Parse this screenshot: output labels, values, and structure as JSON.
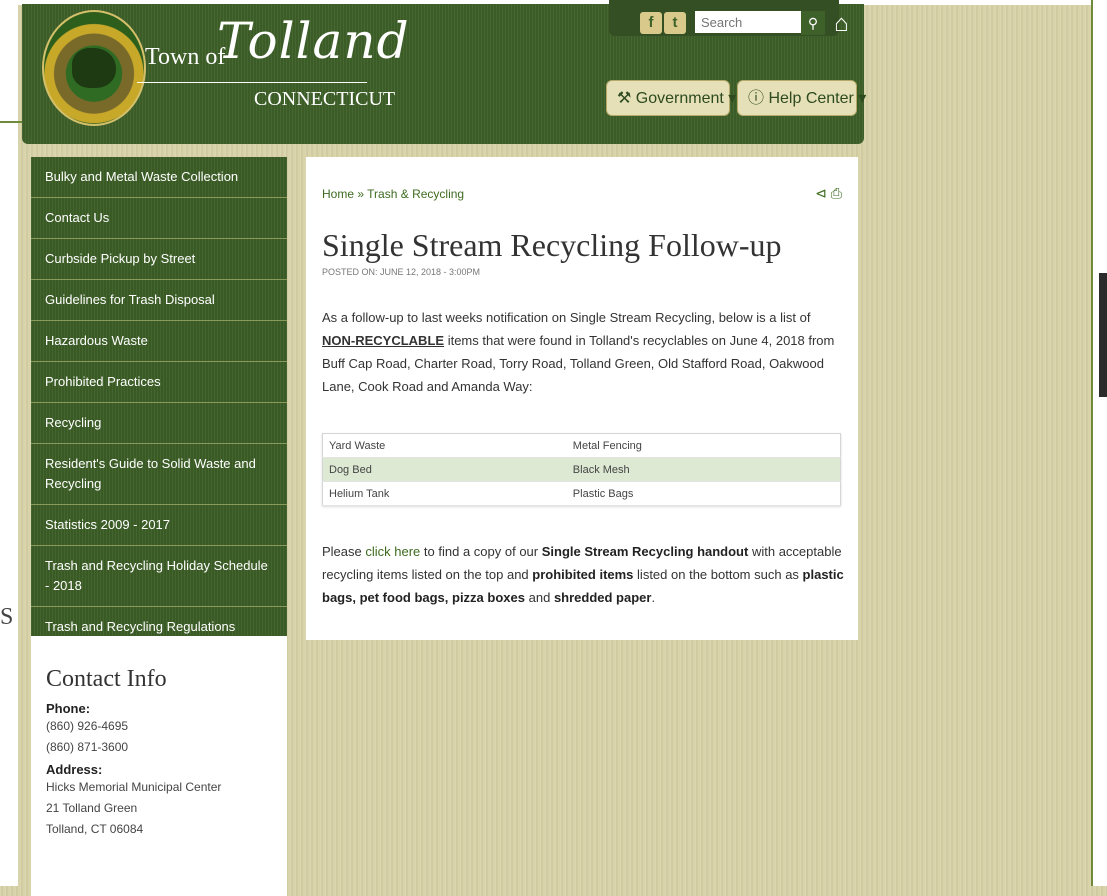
{
  "header": {
    "town_of": "Town of",
    "town_name": "Tolland",
    "state": "CONNECTICUT",
    "search_placeholder": "Search",
    "nav": {
      "government": "Government",
      "help_center": "Help Center"
    }
  },
  "sidebar": {
    "items": [
      "Bulky and Metal Waste Collection",
      "Contact Us",
      "Curbside Pickup by Street",
      "Guidelines for Trash Disposal",
      "Hazardous Waste",
      "Prohibited Practices",
      "Recycling",
      "Resident's Guide to Solid Waste and Recycling",
      "Statistics 2009 - 2017",
      "Trash and Recycling Holiday Schedule - 2018",
      "Trash and Recycling Regulations"
    ]
  },
  "contact": {
    "title": "Contact Info",
    "phone_label": "Phone:",
    "phone1": "(860) 926-4695",
    "phone2": "(860) 871-3600",
    "address_label": "Address:",
    "address1": "Hicks Memorial Municipal Center",
    "address2": "21 Tolland Green",
    "address3": "Tolland, CT 06084"
  },
  "article": {
    "breadcrumb_home": "Home",
    "breadcrumb_sep": "»",
    "breadcrumb_section": "Trash & Recycling",
    "title": "Single Stream Recycling Follow-up",
    "posted": "POSTED ON: JUNE 12, 2018 - 3:00PM",
    "intro_part1": "As a follow-up to last weeks notification on Single Stream Recycling, below is a list of",
    "intro_strong": "NON-RECYCLABLE",
    "intro_part2": "items that were found in Tolland's recyclables on June 4, 2018 from Buff Cap Road, Charter Road, Torry Road, Tolland Green, Old Stafford Road, Oakwood Lane, Cook Road and Amanda Way:",
    "table": [
      [
        "Yard Waste",
        "Metal Fencing"
      ],
      [
        "Dog Bed",
        "Black Mesh"
      ],
      [
        "Helium Tank",
        "Plastic Bags"
      ]
    ],
    "outro_1": "Please",
    "outro_link": "click here",
    "outro_2": "to find a copy of our",
    "outro_b1": "Single Stream Recycling handout",
    "outro_3": "with acceptable recycling items listed on the top and",
    "outro_b2": "prohibited items",
    "outro_4": "listed on the bottom such as",
    "outro_b3": "plastic bags, pet food bags, pizza boxes",
    "outro_5": "and",
    "outro_b4": "shredded paper",
    "outro_6": "."
  },
  "stray_text": "S"
}
